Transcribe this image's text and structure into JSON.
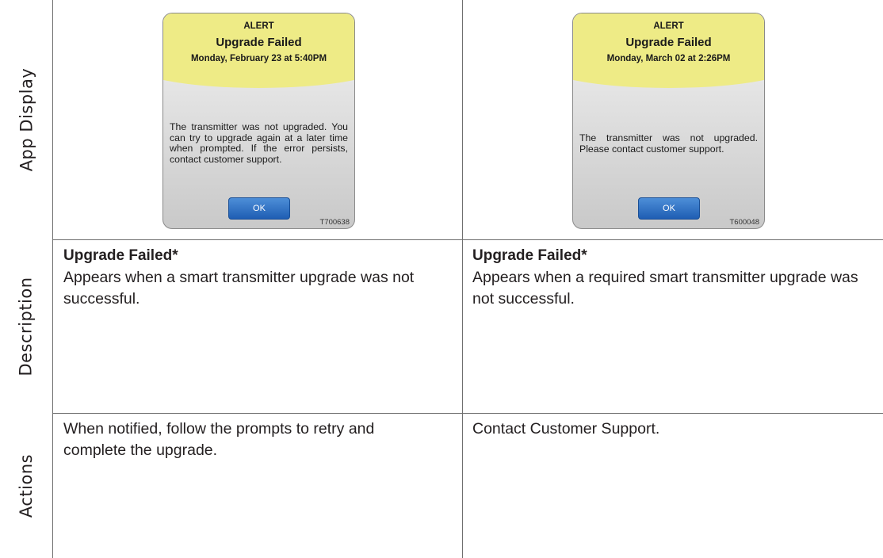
{
  "row_labels": {
    "app_display": "App Display",
    "description": "Description",
    "actions": "Actions"
  },
  "left": {
    "screen": {
      "alert": "ALERT",
      "title": "Upgrade Failed",
      "date": "Monday, February 23 at 5:40PM",
      "message": "The transmitter was not upgraded. You can try to upgrade again at a later time when prompted. If the error persists, contact customer support.",
      "button": "OK",
      "code": "T700638"
    },
    "description_title": "Upgrade Failed*",
    "description_body": "Appears when a smart transmitter upgrade was not successful.",
    "actions": "When notified, follow the prompts to retry and complete the upgrade."
  },
  "right": {
    "screen": {
      "alert": "ALERT",
      "title": "Upgrade Failed",
      "date": "Monday, March 02 at 2:26PM",
      "message": "The transmitter was not upgraded. Please contact customer support.",
      "button": "OK",
      "code": "T600048"
    },
    "description_title": "Upgrade Failed*",
    "description_body": "Appears when a required smart transmitter upgrade was not successful.",
    "actions": "Contact Customer Support."
  },
  "colors": {
    "header_yellow": "#eeeb86",
    "button_blue": "#2a6cc4",
    "grid_line": "#6f6f6f"
  }
}
